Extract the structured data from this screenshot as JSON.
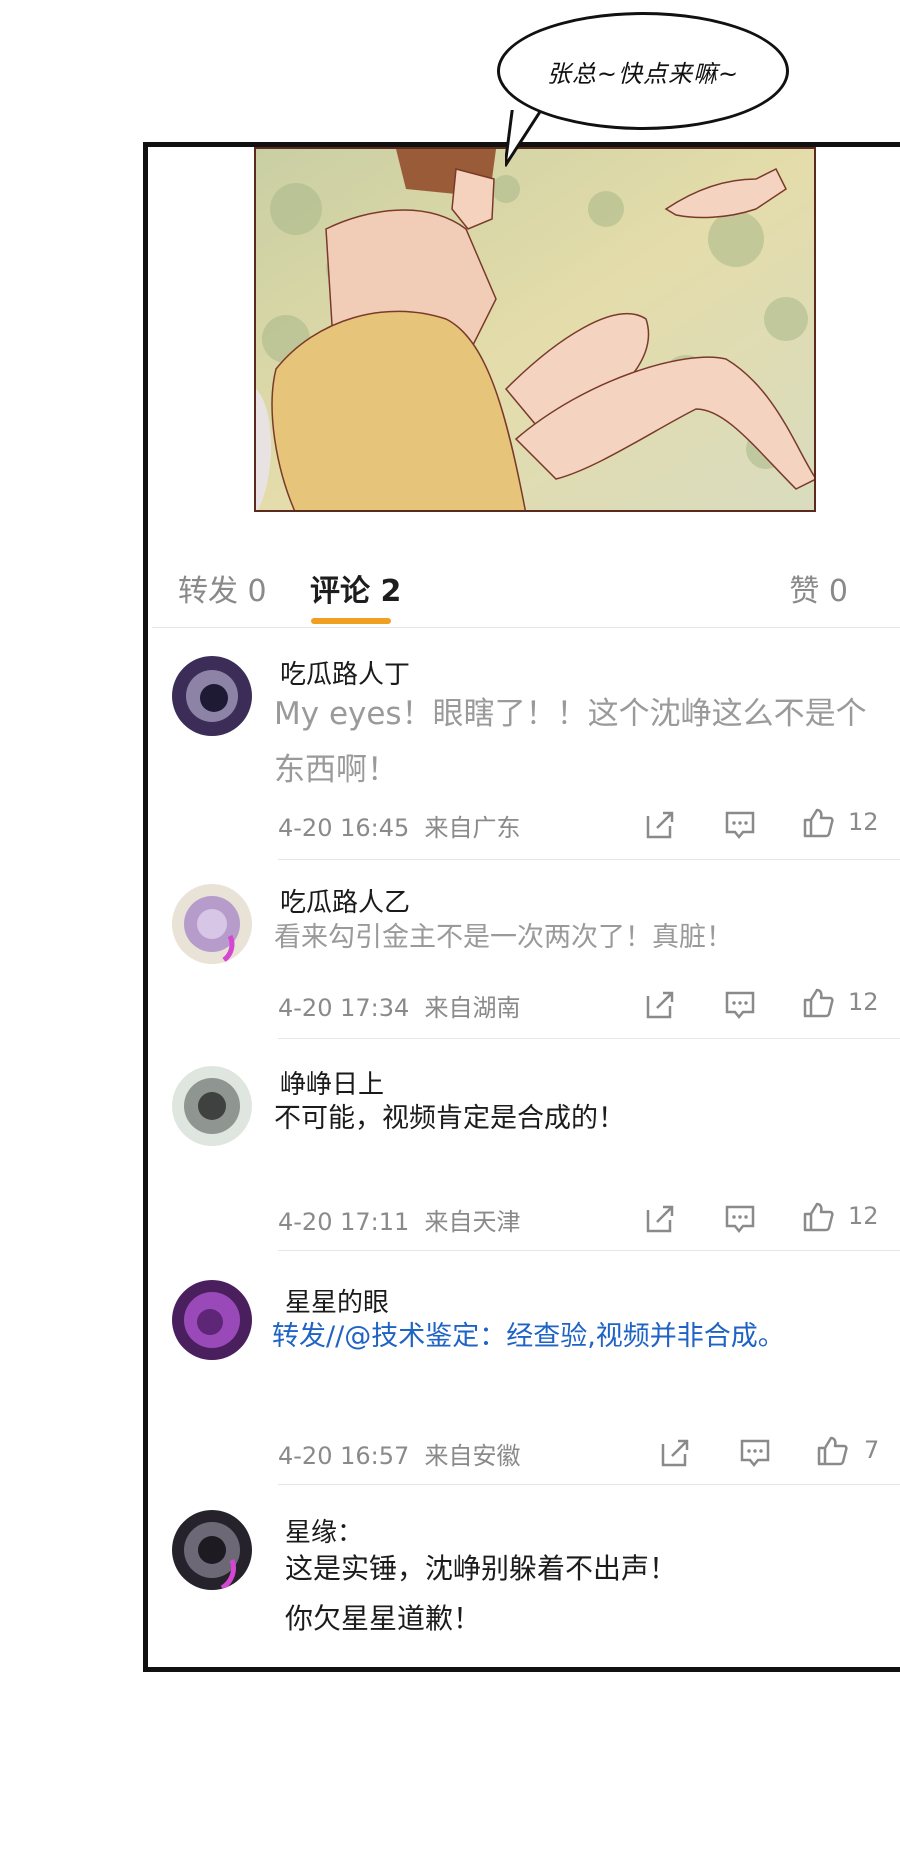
{
  "bubble": {
    "text": "张总~快点来嘛~"
  },
  "tabs": {
    "forward": "转发 0",
    "comments": "评论 2",
    "likes": "赞 0"
  },
  "colors": {
    "accent": "#f0a020",
    "link": "#1f63c4"
  },
  "comments": [
    {
      "user": "吃瓜路人丁",
      "text": "My eyes！眼瞎了！！这个沈峥这么不是个东西啊！",
      "time": "4-20 16:45",
      "from": "来自广东",
      "likes": "12"
    },
    {
      "user": "吃瓜路人乙",
      "text": "看来勾引金主不是一次两次了！真脏！",
      "time": "4-20 17:34",
      "from": "来自湖南",
      "likes": "12"
    },
    {
      "user": "峥峥日上",
      "text": "不可能，视频肯定是合成的！",
      "time": "4-20 17:11",
      "from": "来自天津",
      "likes": "12"
    },
    {
      "user": "星星的眼",
      "text": "转发//@技术鉴定：经查验,视频并非合成。",
      "time": "4-20 16:57",
      "from": "来自安徽",
      "likes": "7"
    },
    {
      "user": "星缘：",
      "line1": "这是实锤，沈峥别躲着不出声！",
      "line2": "你欠星星道歉！"
    }
  ],
  "icons": [
    "share-icon",
    "comment-icon",
    "thumbs-up-icon"
  ]
}
